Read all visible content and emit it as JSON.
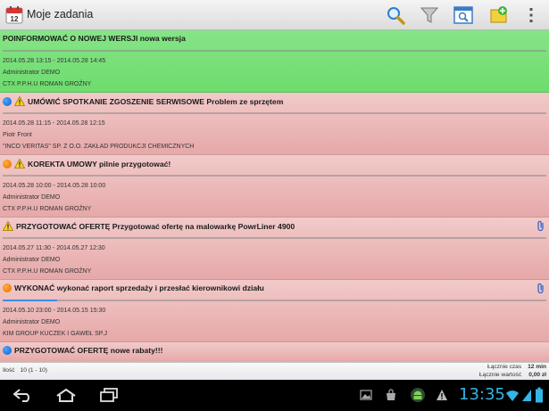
{
  "app": {
    "title": "Moje zadania",
    "calendar_day": "12"
  },
  "tasks": [
    {
      "color": "green",
      "dot": "",
      "warning": false,
      "attachment": false,
      "title": "POINFORMOWAĆ O NOWEJ WERSJI nowa wersja",
      "dates": "2014.05.28 13:15 - 2014.05.28 14:45",
      "person": "Administrator DEMO",
      "company": "CTX P.P.H.U ROMAN GROŹNY",
      "progress": 0
    },
    {
      "color": "red",
      "dot": "blue",
      "warning": true,
      "attachment": false,
      "title": "UMÓWIĆ SPOTKANIE ZGOSZENIE SERWISOWE Problem ze sprzętem",
      "dates": "2014.05.28 11:15 - 2014.05.28 12:15",
      "person": "Piotr Front",
      "company": "\"INCO VERITAS\" SP. Z O.O. ZAKŁAD PRODUKCJI CHEMICZNYCH",
      "progress": 0
    },
    {
      "color": "red",
      "dot": "orange",
      "warning": true,
      "attachment": false,
      "title": "KOREKTA UMOWY pilnie przygotować!",
      "dates": "2014.05.28 10:00 - 2014.05.28 10:00",
      "person": "Administrator DEMO",
      "company": "CTX P.P.H.U ROMAN GROŹNY",
      "progress": 0
    },
    {
      "color": "red",
      "dot": "",
      "warning": true,
      "attachment": true,
      "title": "PRZYGOTOWAĆ OFERTĘ Przygotować ofertę na malowarkę  PowrLiner 4900",
      "dates": "2014.05.27 11:30 - 2014.05.27 12:30",
      "person": "Administrator DEMO",
      "company": "CTX P.P.H.U ROMAN GROŹNY",
      "progress": 0
    },
    {
      "color": "red",
      "dot": "orange",
      "warning": false,
      "attachment": true,
      "title": "WYKONAĆ wykonać raport sprzedaży i przesłać kierownikowi działu",
      "dates": "2014.05.10 23:00 - 2014.05.15 15:30",
      "person": "Administrator DEMO",
      "company": "KIM GROUP KUCZEK I GAWEŁ SP.J",
      "progress": 0.1
    },
    {
      "color": "red",
      "dot": "blue",
      "warning": false,
      "attachment": false,
      "title": "PRZYGOTOWAĆ OFERTĘ nowe rabaty!!!",
      "dates": "",
      "person": "",
      "company": "",
      "progress": 0
    }
  ],
  "footer": {
    "count_label": "Ilość",
    "count_value": "10 (1 - 10)",
    "time_label": "Łącznie czas",
    "time_value": "12 min",
    "value_label": "Łącznie wartość",
    "value_value": "0,00 zł"
  },
  "status": {
    "clock": "13:35"
  },
  "icons": {
    "actionbar": [
      "search-icon",
      "filter-icon",
      "browser-search-icon",
      "add-task-icon",
      "overflow-menu-icon"
    ],
    "navbar": [
      "back-icon",
      "home-icon",
      "recent-apps-icon"
    ],
    "status": [
      "gallery-icon",
      "store-icon",
      "android-icon",
      "warning-icon",
      "wifi-icon",
      "signal-icon",
      "battery-icon"
    ]
  },
  "colors": {
    "green_row": "#76df76",
    "red_row": "#eab5b5",
    "clock": "#33b5e5"
  }
}
